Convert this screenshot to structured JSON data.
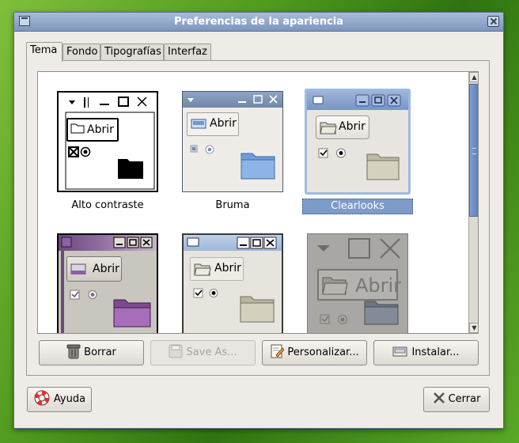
{
  "window": {
    "title": "Preferencias de la apariencia"
  },
  "tabs": [
    {
      "label": "Tema",
      "active": true
    },
    {
      "label": "Fondo"
    },
    {
      "label": "Tipografías"
    },
    {
      "label": "Interfaz"
    }
  ],
  "themes": [
    {
      "name": "Alto contraste",
      "button": "Abrir"
    },
    {
      "name": "Bruma",
      "button": "Abrir"
    },
    {
      "name": "Clearlooks",
      "button": "Abrir",
      "selected": true
    },
    {
      "name": "",
      "button": "Abrir"
    },
    {
      "name": "",
      "button": "Abrir"
    },
    {
      "name": "",
      "button": "Abrir"
    }
  ],
  "actions": {
    "delete": "Borrar",
    "save_as": "Save As...",
    "customize": "Personalizar...",
    "install": "Instalar..."
  },
  "footer": {
    "help": "Ayuda",
    "close": "Cerrar"
  },
  "colors": {
    "selection": "#7d9bc9",
    "titlebar": "#7d96be"
  }
}
